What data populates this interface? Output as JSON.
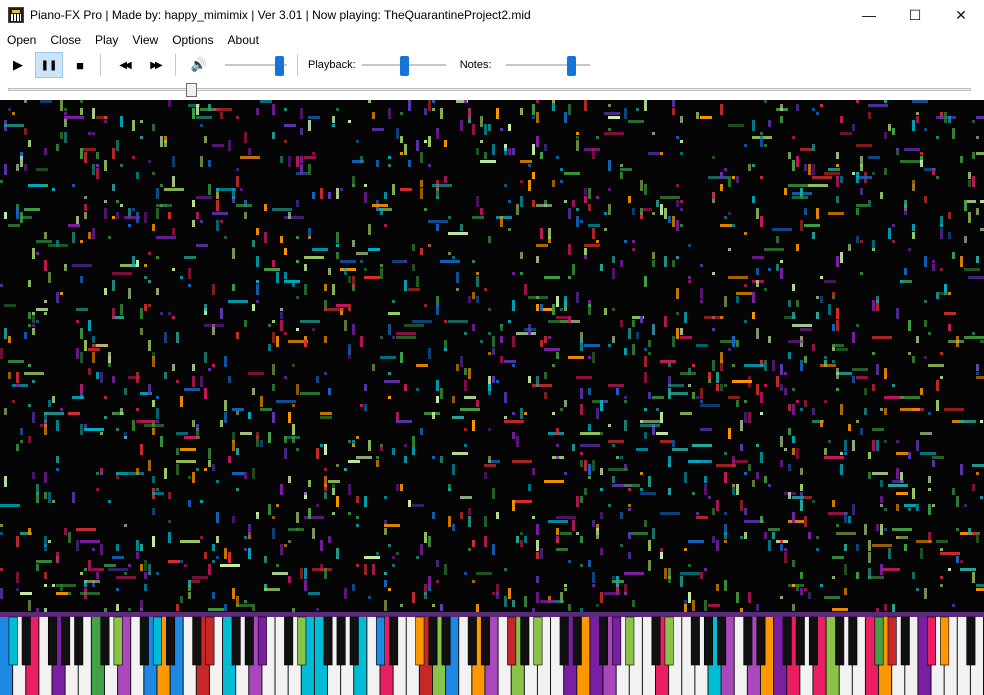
{
  "window": {
    "title": "Piano-FX Pro | Made by: happy_mimimix | Ver 3.01 | Now playing: TheQuarantineProject2.mid",
    "minimize_glyph": "—",
    "maximize_glyph": "☐",
    "close_glyph": "✕"
  },
  "menu": {
    "items": [
      "Open",
      "Close",
      "Play",
      "View",
      "Options",
      "About"
    ]
  },
  "toolbar": {
    "play_glyph": "▶",
    "pause_glyph": "❚❚",
    "stop_glyph": "■",
    "rewind_glyph": "◀◀",
    "forward_glyph": "▶▶",
    "volume_glyph": "🔊",
    "volume_level": 0.95,
    "playback_label": "Playback:",
    "playback_level": 0.5,
    "notes_label": "Notes:",
    "notes_level": 0.82
  },
  "seek": {
    "position": 0.19
  },
  "colors": {
    "accent": "#1673d8",
    "pause_active": "#cce4f7",
    "stage_background": "#050505",
    "note_palette": [
      "#c8f0a8",
      "#2e7d32",
      "#7b1fa2",
      "#c2185b",
      "#1565c0",
      "#00acc1",
      "#ff9800",
      "#43a047",
      "#d32f2f",
      "#9ccc65",
      "#5e35b1",
      "#26a69a"
    ],
    "key_highlight": [
      "#7b1fa2",
      "#e91e63",
      "#43a047",
      "#ff9800",
      "#1e88e5",
      "#00bcd4",
      "#c62828",
      "#8bc34a",
      "#ab47bc"
    ]
  },
  "icons": [
    "app-piano-icon",
    "minimize-icon",
    "maximize-icon",
    "close-icon",
    "play-icon",
    "pause-icon",
    "stop-icon",
    "rewind-icon",
    "fast-forward-icon",
    "volume-icon"
  ]
}
